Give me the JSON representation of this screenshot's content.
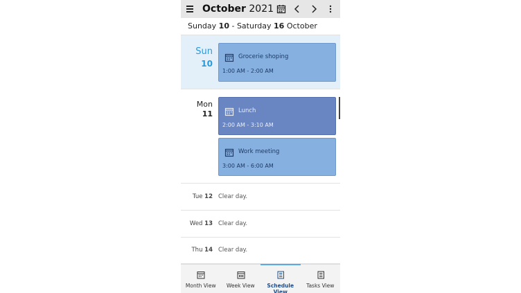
{
  "header": {
    "month": "October",
    "year": "2021",
    "menu_icon": "hamburger-icon",
    "calendar_icon": "calendar-icon",
    "prev_icon": "chevron-left-icon",
    "next_icon": "chevron-right-icon",
    "more_icon": "more-vertical-icon"
  },
  "range": {
    "start_day": "Sunday",
    "start_num": "10",
    "separator": " - ",
    "end_day": "Saturday",
    "end_num": "16",
    "month": "October"
  },
  "days": [
    {
      "name": "Sun",
      "num": "10",
      "today": true,
      "events": [
        {
          "title": "Grocerie shoping",
          "time": "1:00 AM - 2:00 AM",
          "icon": "calendar-event-icon"
        }
      ]
    },
    {
      "name": "Mon",
      "num": "11",
      "today": false,
      "events": [
        {
          "title": "Lunch",
          "time": "2:00 AM - 3:10 AM",
          "icon": "calendar-event-icon"
        },
        {
          "title": "Work meeting",
          "time": "3:00 AM - 6:00 AM",
          "icon": "calendar-event-icon"
        }
      ]
    }
  ],
  "clear_days": [
    {
      "name": "Tue",
      "num": "12",
      "text": "Clear day."
    },
    {
      "name": "Wed",
      "num": "13",
      "text": "Clear day."
    },
    {
      "name": "Thu",
      "num": "14",
      "text": "Clear day."
    }
  ],
  "bottom_nav": [
    {
      "label": "Month View",
      "icon": "month-view-icon",
      "active": false
    },
    {
      "label": "Week View",
      "icon": "week-view-icon",
      "active": false
    },
    {
      "label": "Schedule View",
      "icon": "schedule-view-icon",
      "active": true
    },
    {
      "label": "Tasks View",
      "icon": "tasks-view-icon",
      "active": false
    }
  ],
  "colors": {
    "accent": "#2b9ad8",
    "today_bg": "#e3f0fa",
    "event_light": "#86b0e0",
    "event_dark": "#6a86c2"
  }
}
